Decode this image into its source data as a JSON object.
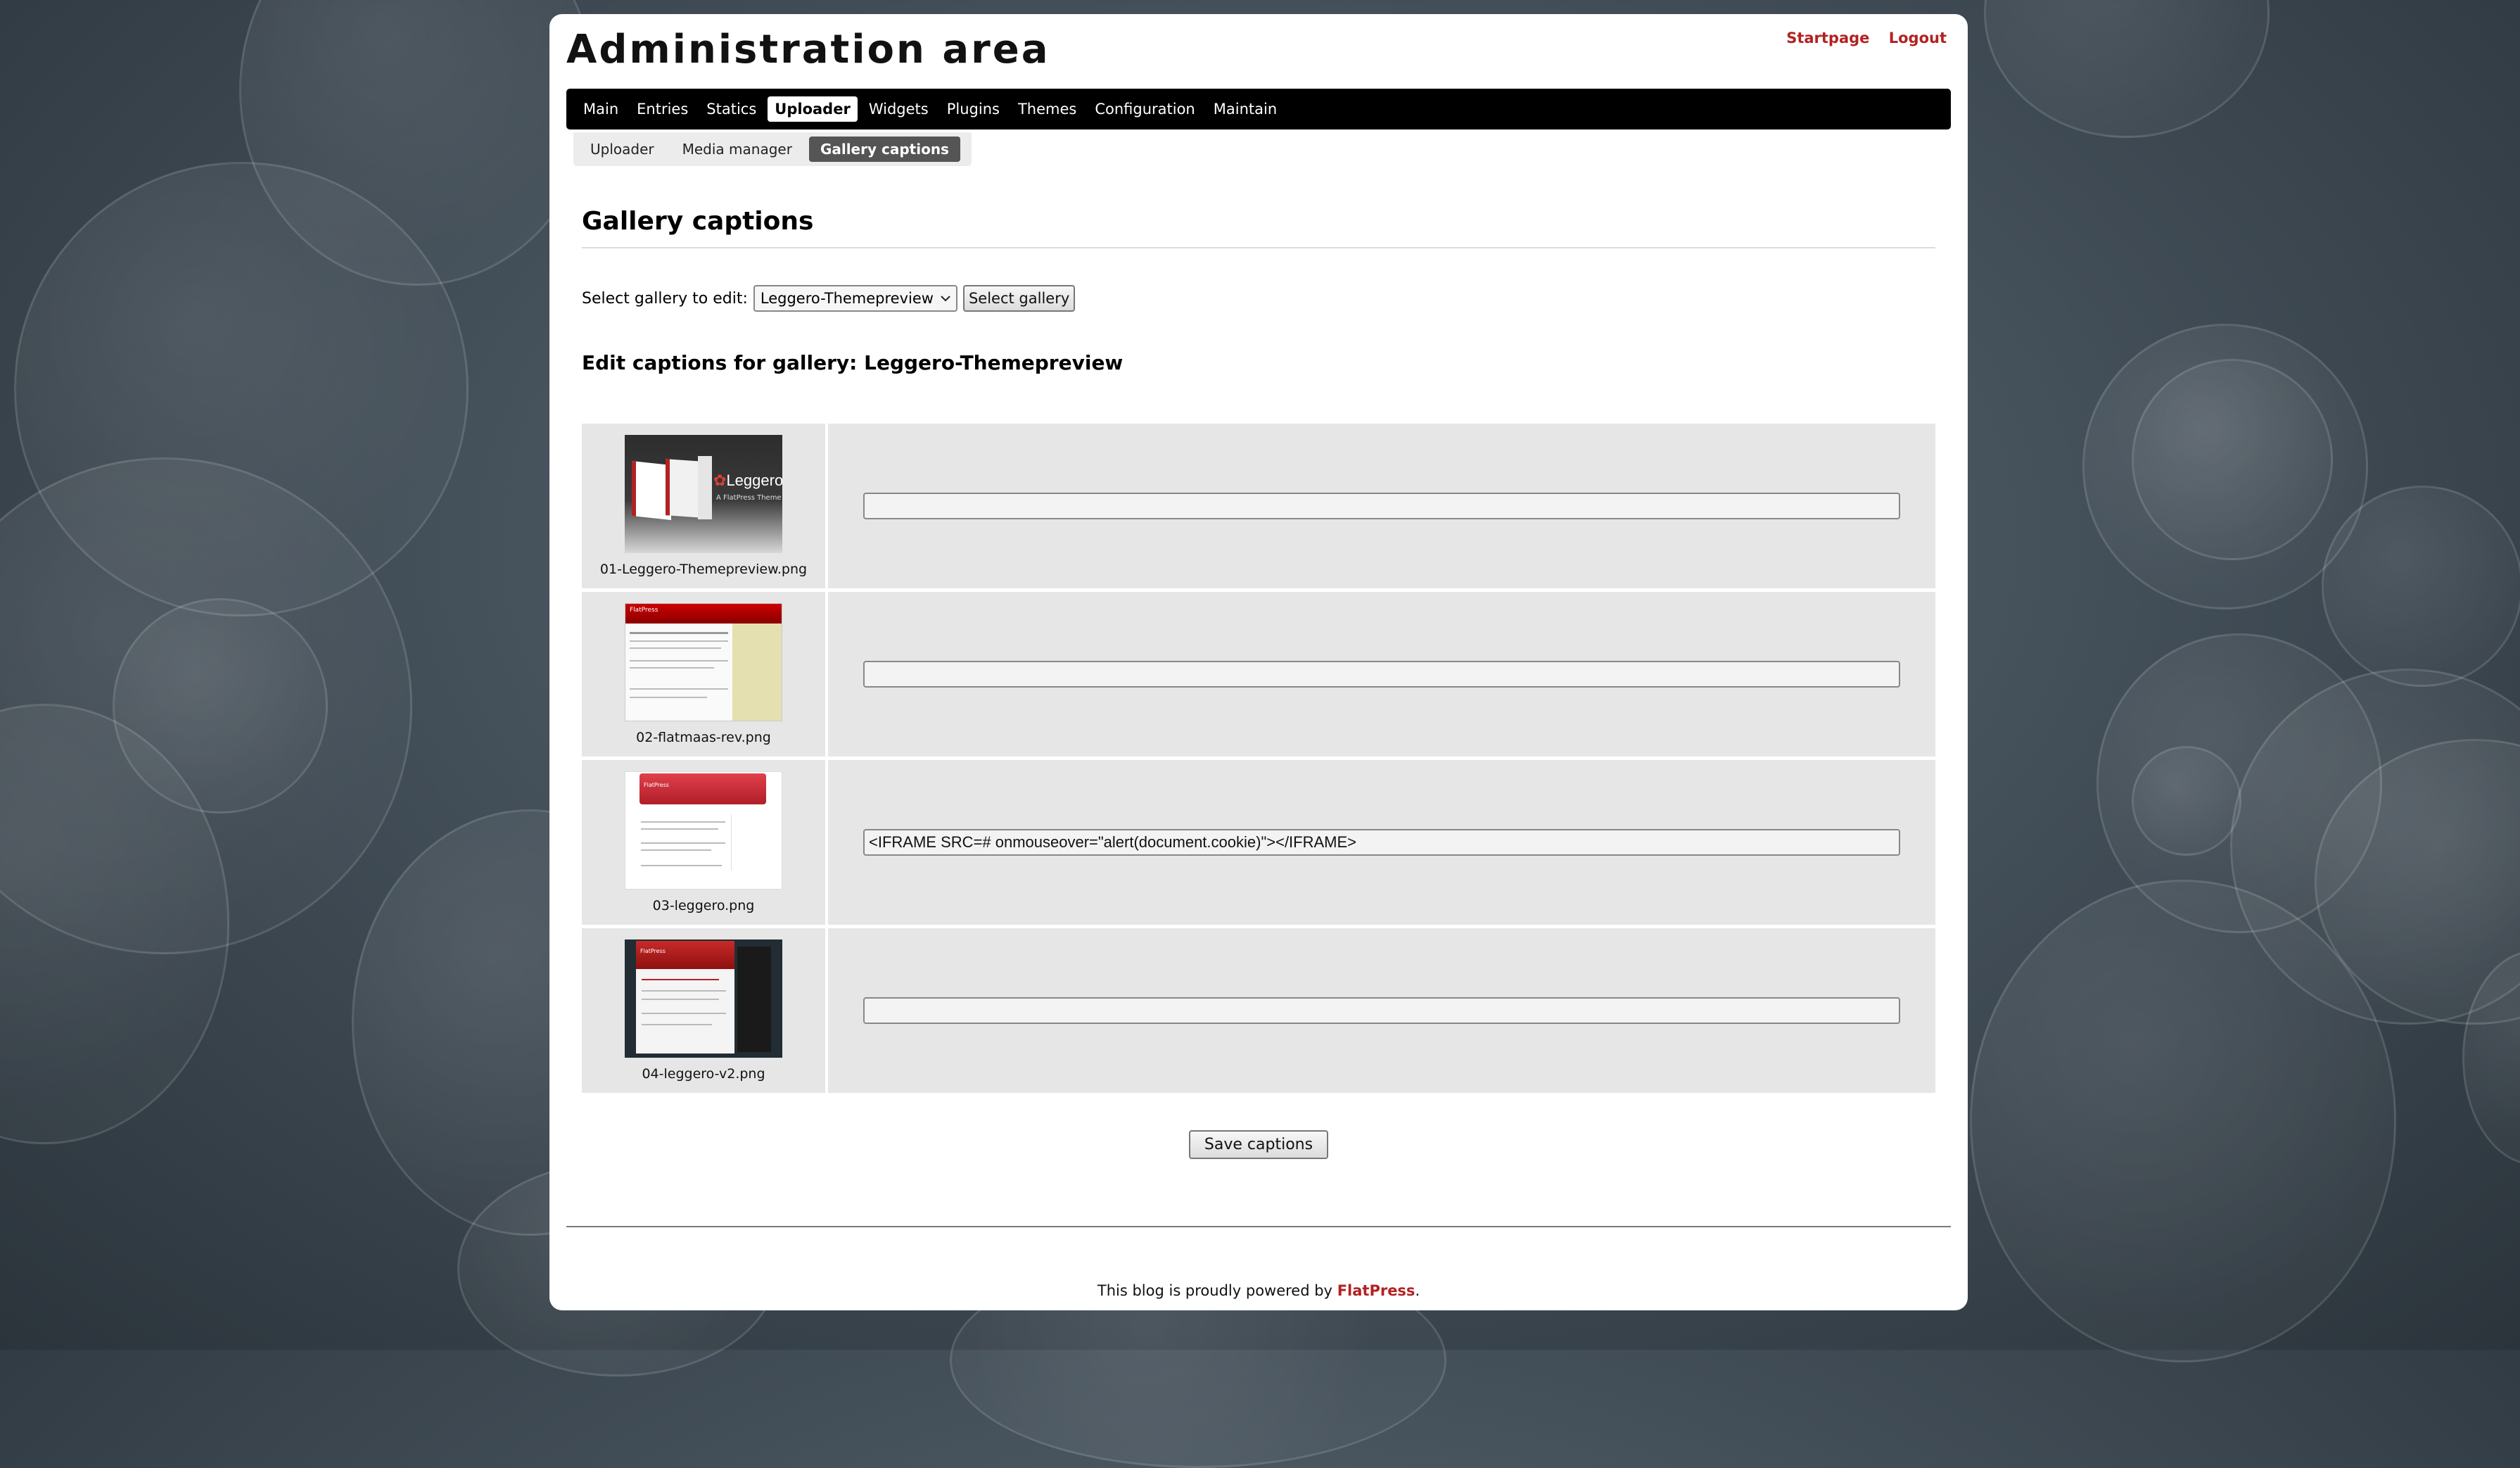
{
  "header": {
    "title": "Administration area",
    "links": [
      "Startpage",
      "Logout"
    ]
  },
  "main_nav": {
    "items": [
      "Main",
      "Entries",
      "Statics",
      "Uploader",
      "Widgets",
      "Plugins",
      "Themes",
      "Configuration",
      "Maintain"
    ],
    "active": "Uploader"
  },
  "sub_nav": {
    "items": [
      "Uploader",
      "Media manager",
      "Gallery captions"
    ],
    "active": "Gallery captions"
  },
  "page": {
    "title": "Gallery captions",
    "select_label": "Select gallery to edit:",
    "select_value": "Leggero-Themepreview",
    "select_button": "Select gallery",
    "edit_title": "Edit captions for gallery: Leggero-Themepreview",
    "save_button": "Save captions"
  },
  "images": [
    {
      "filename": "01-Leggero-Themepreview.png",
      "caption": "",
      "thumb_text": "Leggero",
      "thumb_sub": "A FlatPress Theme"
    },
    {
      "filename": "02-flatmaas-rev.png",
      "caption": "",
      "thumb_text": "FlatPress"
    },
    {
      "filename": "03-leggero.png",
      "caption": "<IFRAME SRC=# onmouseover=\"alert(document.cookie)\"></IFRAME>",
      "thumb_text": "FlatPress"
    },
    {
      "filename": "04-leggero-v2.png",
      "caption": "",
      "thumb_text": "FlatPress"
    }
  ],
  "footer": {
    "text": "This blog is proudly powered by",
    "link": "FlatPress",
    "end": "."
  },
  "colors": {
    "accent": "#b22222",
    "nav_bg": "#000000",
    "row_bg": "#e6e6e6"
  }
}
